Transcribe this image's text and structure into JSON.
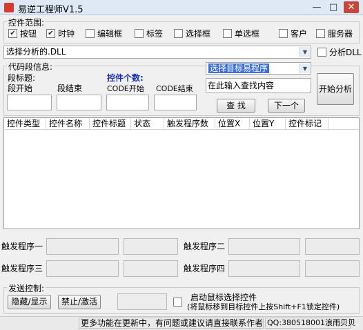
{
  "window": {
    "title": "易逆工程师V1.5",
    "min": "—",
    "max": "□",
    "close": "✕"
  },
  "scope": {
    "legend": "控件范围:",
    "items": [
      {
        "label": "按钮",
        "checked": true
      },
      {
        "label": "时钟",
        "checked": true
      },
      {
        "label": "编辑框",
        "checked": false
      },
      {
        "label": "标签",
        "checked": false
      },
      {
        "label": "选择框",
        "checked": false
      },
      {
        "label": "单选框",
        "checked": false
      },
      {
        "label": "客户",
        "checked": false
      },
      {
        "label": "服务器",
        "checked": false
      }
    ]
  },
  "dll": {
    "value": "选择分析的.DLL",
    "analyze_label": "分析DLL",
    "analyze_checked": false
  },
  "code": {
    "legend": "代码段信息:",
    "segment_title": "段标题:",
    "segment_start": "段开始",
    "segment_end": "段结束",
    "count_label": "控件个数:",
    "code_start": "CODE开始",
    "code_end": "CODE结束"
  },
  "search": {
    "target_value": "选择目标易程序",
    "query_value": "在此输入查找内容",
    "find_label": "查 找",
    "next_label": "下一个",
    "start_label": "开始分析"
  },
  "table": {
    "columns": [
      "控件类型",
      "控件名称",
      "控件标题",
      "状态",
      "触发程序数",
      "位置X",
      "位置Y",
      "控件标记"
    ]
  },
  "triggers": {
    "t1": "触发程序一",
    "t2": "触发程序二",
    "t3": "触发程序三",
    "t4": "触发程序四"
  },
  "send": {
    "legend": "发送控制:",
    "hide_show": "隐藏/显示",
    "stop_activate": "禁止/激活",
    "mouse_select": "启动鼠标选择控件",
    "mouse_hint": "(将鼠标移到目标控件上按Shift+F1锁定控件)",
    "mouse_checked": false
  },
  "statusbar": {
    "message": "更多功能在更新中，有问题或建议请直接联系作者",
    "contact": "QQ:380518001浪雨贝贝"
  }
}
